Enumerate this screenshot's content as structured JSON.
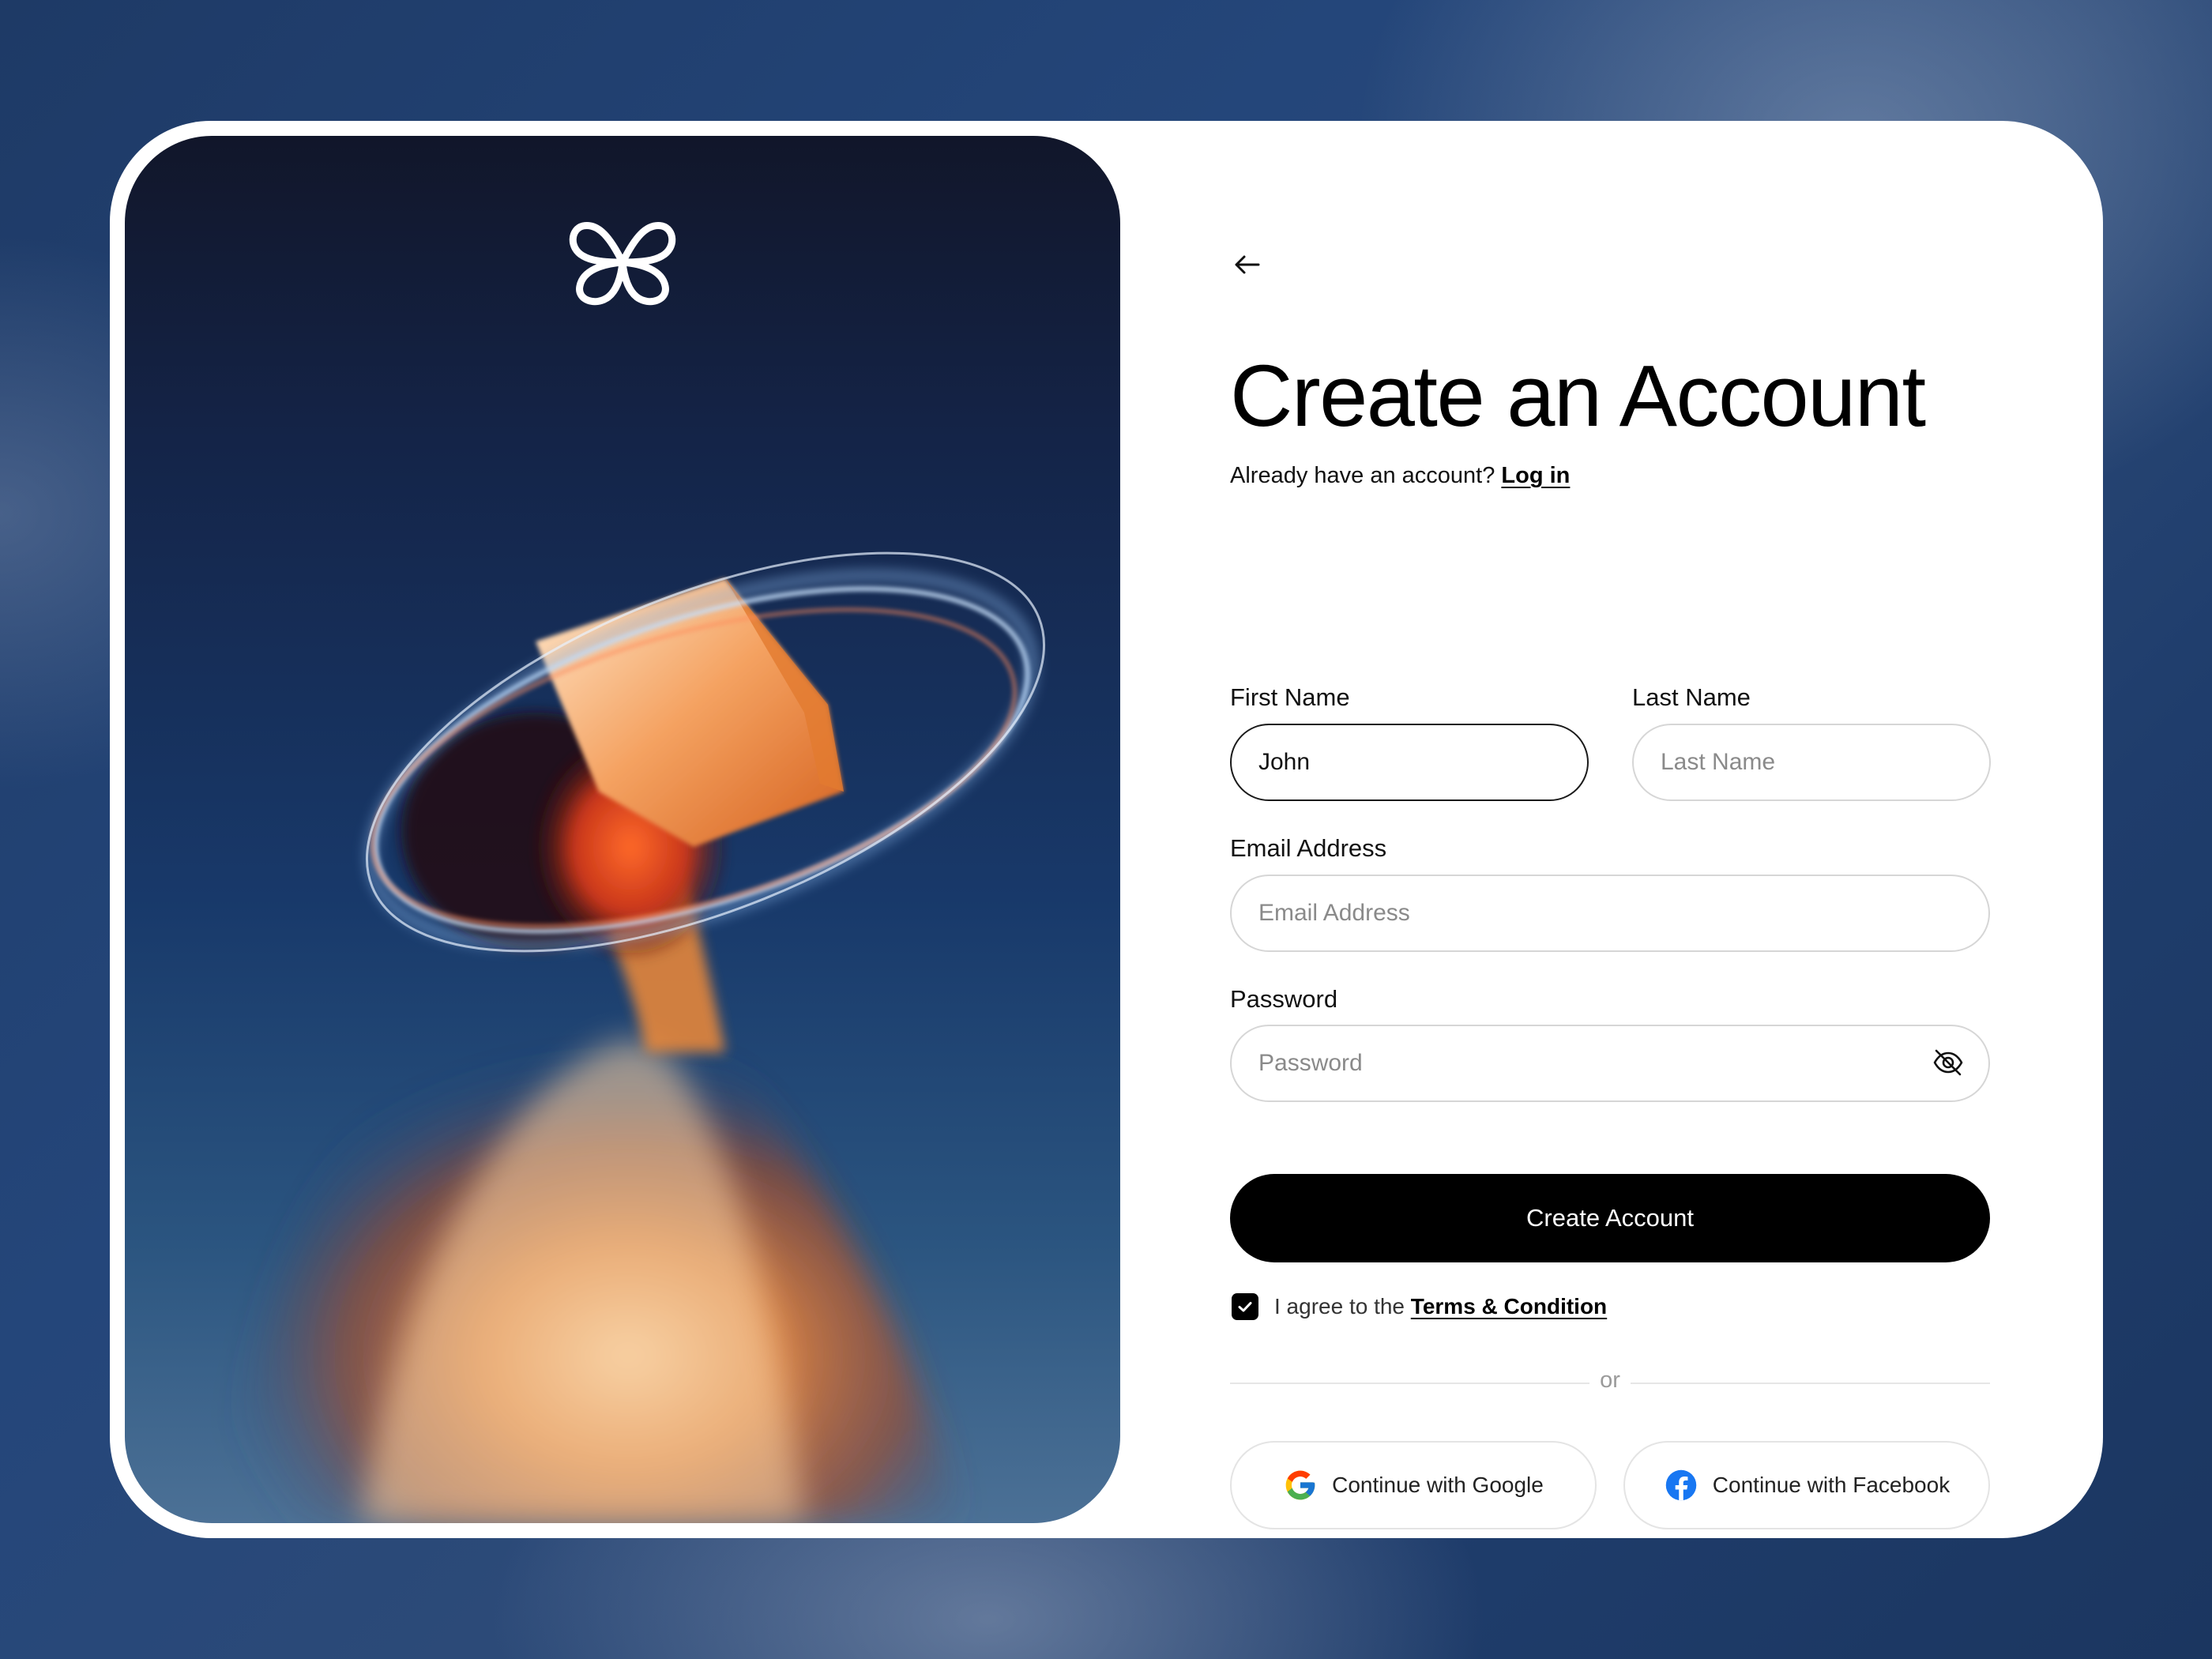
{
  "form": {
    "title": "Create an Account",
    "subtitle_prefix": "Already have an account? ",
    "login_link": "Log in",
    "first_name": {
      "label": "First Name",
      "value": "John"
    },
    "last_name": {
      "label": "Last Name",
      "placeholder": "Last Name"
    },
    "email": {
      "label": "Email Address",
      "placeholder": "Email Address"
    },
    "password": {
      "label": "Password",
      "placeholder": "Password"
    },
    "submit_label": "Create Account",
    "agree_prefix": "I agree to the ",
    "terms_link": "Terms & Condition",
    "agree_checked": true,
    "divider_text": "or",
    "google_label": "Continue with Google",
    "facebook_label": "Continue with Facebook"
  },
  "icons": {
    "back": "arrow-left-icon",
    "logo": "butterfly-logo-icon",
    "password_toggle": "eye-off-icon",
    "checkbox": "check-icon",
    "google": "google-icon",
    "facebook": "facebook-icon"
  },
  "colors": {
    "primary": "#000000",
    "field_border": "#d6d6d6",
    "background": "#1f3d6c",
    "facebook_blue": "#1877f2"
  }
}
